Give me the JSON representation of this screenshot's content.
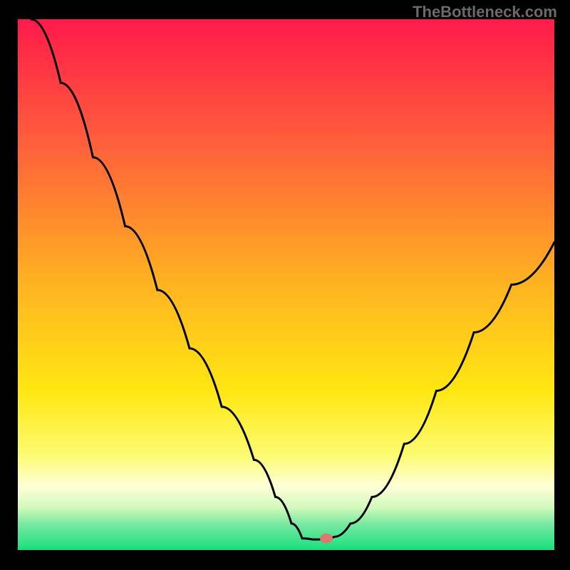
{
  "attribution": "TheBottleneck.com",
  "chart_data": {
    "type": "line",
    "title": "",
    "xlabel": "",
    "ylabel": "",
    "xlim": [
      0,
      100
    ],
    "ylim": [
      0,
      100
    ],
    "gradient_stops": [
      {
        "offset": 0,
        "color": "#ff1a4a"
      },
      {
        "offset": 25,
        "color": "#ff643a"
      },
      {
        "offset": 50,
        "color": "#ffb321"
      },
      {
        "offset": 70,
        "color": "#ffe712"
      },
      {
        "offset": 82,
        "color": "#fcfb70"
      },
      {
        "offset": 88,
        "color": "#ffffd8"
      },
      {
        "offset": 92,
        "color": "#d2f9bb"
      },
      {
        "offset": 95,
        "color": "#7ae9a3"
      },
      {
        "offset": 100,
        "color": "#17e07e"
      }
    ],
    "series": [
      {
        "name": "bottleneck-curve",
        "points": [
          {
            "x": 2.5,
            "y": 100
          },
          {
            "x": 8,
            "y": 88
          },
          {
            "x": 14,
            "y": 74
          },
          {
            "x": 20,
            "y": 61
          },
          {
            "x": 26,
            "y": 49
          },
          {
            "x": 32,
            "y": 38
          },
          {
            "x": 38,
            "y": 27
          },
          {
            "x": 44,
            "y": 17
          },
          {
            "x": 48,
            "y": 10
          },
          {
            "x": 51,
            "y": 5
          },
          {
            "x": 53,
            "y": 2.2
          },
          {
            "x": 55,
            "y": 2.0
          },
          {
            "x": 57,
            "y": 2.0
          },
          {
            "x": 59,
            "y": 2.5
          },
          {
            "x": 62,
            "y": 5
          },
          {
            "x": 66,
            "y": 10
          },
          {
            "x": 72,
            "y": 20
          },
          {
            "x": 78,
            "y": 30
          },
          {
            "x": 85,
            "y": 41
          },
          {
            "x": 92,
            "y": 50
          },
          {
            "x": 100,
            "y": 58
          }
        ]
      }
    ],
    "marker": {
      "x": 57.5,
      "y": 2.2,
      "color": "#d97a6f"
    }
  }
}
